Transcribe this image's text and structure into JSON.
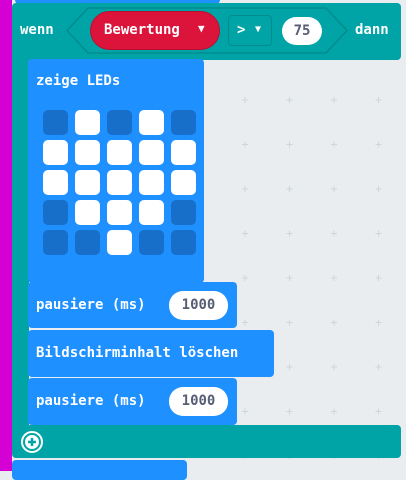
{
  "if_block": {
    "keyword_if": "wenn",
    "keyword_then": "dann",
    "variable": "Bewertung",
    "operator": ">",
    "value": "75",
    "color": "#00a4a6"
  },
  "show_leds": {
    "label": "zeige LEDs",
    "leds": [
      [
        0,
        1,
        0,
        1,
        0
      ],
      [
        1,
        1,
        1,
        1,
        1
      ],
      [
        1,
        1,
        1,
        1,
        1
      ],
      [
        0,
        1,
        1,
        1,
        0
      ],
      [
        0,
        0,
        1,
        0,
        0
      ]
    ]
  },
  "pause1": {
    "label": "pausiere (ms)",
    "value": "1000"
  },
  "clear": {
    "label": "Bildschirminhalt löschen"
  },
  "pause2": {
    "label": "pausiere (ms)",
    "value": "1000"
  },
  "add_icon": "plus-circle-icon"
}
